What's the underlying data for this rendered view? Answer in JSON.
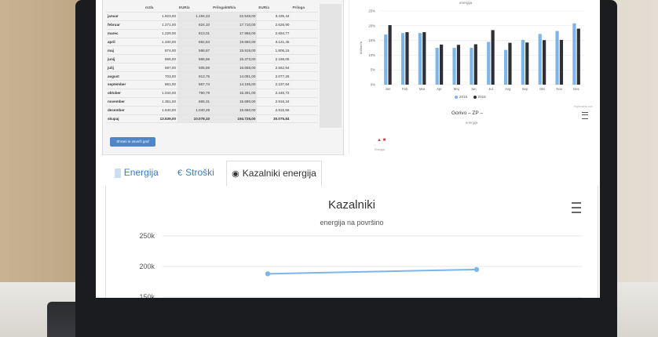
{
  "table": {
    "headers": [
      "",
      "m3/a",
      "EUR/a",
      "PrilogakWh/a",
      "EUR/a",
      "Priloga"
    ],
    "rows": [
      {
        "month": "januar",
        "m3": "1.923,00",
        "eur": "1.194,23",
        "kwh": "22.548,00",
        "eur2": "3.435,44"
      },
      {
        "month": "februar",
        "m3": "1.271,00",
        "eur": "824,10",
        "kwh": "17.710,00",
        "eur2": "2.626,90"
      },
      {
        "month": "marec",
        "m3": "1.229,00",
        "eur": "813,01",
        "kwh": "17.966,00",
        "eur2": "2.694,77"
      },
      {
        "month": "april",
        "m3": "1.330,00",
        "eur": "862,84",
        "kwh": "19.660,00",
        "eur2": "3.121,45"
      },
      {
        "month": "maj",
        "m3": "874,00",
        "eur": "568,67",
        "kwh": "15.919,00",
        "eur2": "1.806,15"
      },
      {
        "month": "junij",
        "m3": "866,00",
        "eur": "666,56",
        "kwh": "15.373,00",
        "eur2": "2.166,05"
      },
      {
        "month": "julij",
        "m3": "697,00",
        "eur": "505,59",
        "kwh": "16.658,00",
        "eur2": "2.562,94"
      },
      {
        "month": "avgust",
        "m3": "703,00",
        "eur": "913,75",
        "kwh": "14.091,00",
        "eur2": "2.077,26"
      },
      {
        "month": "september",
        "m3": "861,00",
        "eur": "667,74",
        "kwh": "14.155,00",
        "eur2": "2.237,84"
      },
      {
        "month": "oktober",
        "m3": "1.044,00",
        "eur": "790,79",
        "kwh": "15.281,00",
        "eur2": "2.446,72"
      },
      {
        "month": "november",
        "m3": "1.351,00",
        "eur": "865,31",
        "kwh": "15.690,00",
        "eur2": "2.916,34"
      },
      {
        "month": "december",
        "m3": "1.640,00",
        "eur": "1.040,29",
        "kwh": "19.660,00",
        "eur2": "2.915,56"
      }
    ],
    "total": {
      "month": "skupaj",
      "m3": "13.539,00",
      "eur": "10.078,10",
      "kwh": "194.725,00",
      "eur2": "30.075,84"
    },
    "show_button": "Shrani in osveži graf"
  },
  "top_chart": {
    "subtitle": "energija",
    "yaxis_label": "kWh/m²a",
    "credit": "Highcharts.com",
    "legend": [
      "2015",
      "2016"
    ],
    "second_title": "Gorivo – ZP –",
    "second_subtitle": "energija",
    "mini_label": "Energija"
  },
  "tabs": [
    {
      "label": "Energija",
      "icon": "bar-chart-icon"
    },
    {
      "label": "Stroški",
      "icon": "euro-icon"
    },
    {
      "label": "Kazalniki energija",
      "icon": "gauge-icon"
    }
  ],
  "colors": {
    "series_a": "#7cb5ec",
    "series_b": "#2f2f36",
    "accent": "#3b7dc4"
  },
  "chart_data": [
    {
      "type": "bar",
      "categories": [
        "Jan",
        "Feb",
        "Mar",
        "Apr",
        "Maj",
        "Jun",
        "Jul",
        "Avg",
        "Sep",
        "Okt",
        "Nov",
        "Dec"
      ],
      "ylim": [
        0,
        25
      ],
      "yticks": [
        "0%",
        "5%",
        "10%",
        "15%",
        "20%",
        "25%"
      ],
      "series": [
        {
          "name": "2015",
          "values": [
            17,
            17.5,
            17.5,
            12.5,
            12.5,
            12.5,
            14.5,
            11.8,
            15.2,
            17.2,
            18.2,
            20.8
          ]
        },
        {
          "name": "2016",
          "values": [
            20.2,
            17.8,
            17.8,
            13.6,
            13.5,
            13.7,
            18.5,
            14.2,
            14.3,
            15.1,
            15.2,
            19
          ]
        }
      ]
    },
    {
      "type": "line",
      "title": "Kazalniki",
      "subtitle": "energija na površino",
      "ylim": [
        150000,
        250000
      ],
      "yticks": [
        "150k",
        "200k",
        "250k"
      ],
      "series": [
        {
          "values": [
            188000,
            195000
          ]
        }
      ]
    }
  ]
}
